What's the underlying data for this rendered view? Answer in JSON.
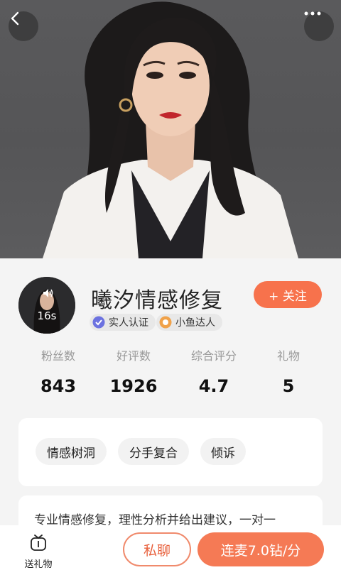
{
  "profile": {
    "name": "曦汐情感修复",
    "avatar_duration": "16s",
    "follow_label": "+ 关注",
    "badges": {
      "real": "实人认证",
      "fish": "小鱼达人"
    }
  },
  "stats": [
    {
      "label": "粉丝数",
      "value": "843"
    },
    {
      "label": "好评数",
      "value": "1926"
    },
    {
      "label": "综合评分",
      "value": "4.7"
    },
    {
      "label": "礼物",
      "value": "5"
    }
  ],
  "tags": [
    "情感树洞",
    "分手复合",
    "倾诉"
  ],
  "description": "专业情感修复，理性分析并给出建议，一对一",
  "bottom": {
    "gift_label": "送礼物",
    "chat_label": "私聊",
    "call_label": "连麦7.0钻/分"
  },
  "colors": {
    "accent": "#f7724c",
    "call": "#f57a55"
  },
  "icons": [
    "back-icon",
    "more-icon",
    "sound-icon",
    "verified-icon",
    "fish-badge-icon",
    "gift-icon"
  ]
}
